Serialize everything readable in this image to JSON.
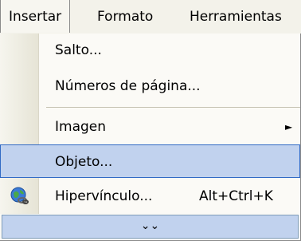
{
  "menubar": {
    "items": [
      {
        "label": "Insertar"
      },
      {
        "label": "Formato"
      },
      {
        "label": "Herramientas"
      }
    ]
  },
  "menu": {
    "items": [
      {
        "label": "Salto..."
      },
      {
        "label": "Números de página..."
      },
      {
        "label": "Imagen",
        "submenu_arrow": "►"
      },
      {
        "label": "Objeto..."
      },
      {
        "label": "Hipervínculo...",
        "shortcut": "Alt+Ctrl+K",
        "icon": "hyperlink-globe-icon"
      }
    ],
    "expand_glyph": "⌄⌄"
  },
  "colors": {
    "highlight": "#c1d2ee",
    "highlight_border": "#316ac5",
    "menubar_bg": "#f3f2ea",
    "menu_bg": "#fbfaf6"
  }
}
